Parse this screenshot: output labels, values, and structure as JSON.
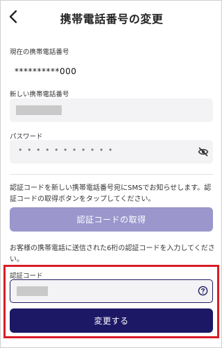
{
  "header": {
    "back_icon": "chevron-left-icon",
    "title": "携帯電話番号の変更"
  },
  "current_phone": {
    "label": "現在の携帯電話番号",
    "value": "**********000"
  },
  "new_phone": {
    "label": "新しい携帯電話番号",
    "value_masked": true
  },
  "password": {
    "label": "パスワード",
    "value_dots": "• • • • • • • • • • •",
    "toggle_icon": "eye-off-icon"
  },
  "sms_note": "認証コードを新しい携帯電話番号宛にSMSでお知らせします。認証コードの取得ボタンをタップしてください。",
  "request_code_button": "認証コードの取得",
  "code_note": "お客様の携帯電話に送信された6桁の認証コードを入力してください。",
  "code": {
    "label": "認証コード",
    "value_masked": true,
    "help_icon": "question-circle-icon"
  },
  "submit_button": "変更する",
  "colors": {
    "primary": "#1c1866",
    "disabled_button": "#9b96cc",
    "highlight": "#d81d25",
    "field_bg": "#f3f3f5"
  }
}
